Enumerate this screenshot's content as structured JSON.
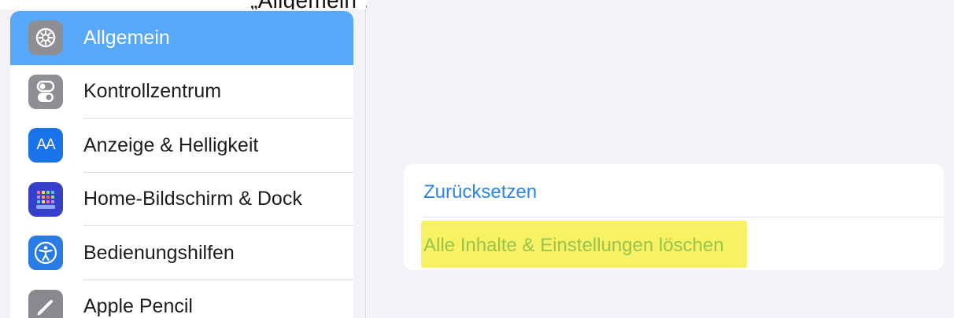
{
  "top_caption": "„Allgemein“, „Zurücksetzen“ und „Alle Inhalte & Einstellungen löschen“ tippen",
  "sidebar": {
    "items": [
      {
        "label": "Allgemein",
        "icon": "gear-icon",
        "selected": true
      },
      {
        "label": "Kontrollzentrum",
        "icon": "toggles-icon",
        "selected": false
      },
      {
        "label": "Anzeige & Helligkeit",
        "icon": "text-size-icon",
        "icon_text": "AA",
        "selected": false
      },
      {
        "label": "Home-Bildschirm & Dock",
        "icon": "app-grid-icon",
        "selected": false
      },
      {
        "label": "Bedienungshilfen",
        "icon": "accessibility-icon",
        "selected": false
      },
      {
        "label": "Apple Pencil",
        "icon": "pencil-icon",
        "selected": false
      }
    ]
  },
  "detail": {
    "reset_group": {
      "items": [
        {
          "label": "Zurücksetzen"
        },
        {
          "label": "Alle Inhalte & Einstellungen löschen",
          "highlighted": true
        }
      ]
    }
  },
  "colors": {
    "selection": "#58a8f9",
    "link": "#2a85e6",
    "highlight": "#f6f264"
  }
}
